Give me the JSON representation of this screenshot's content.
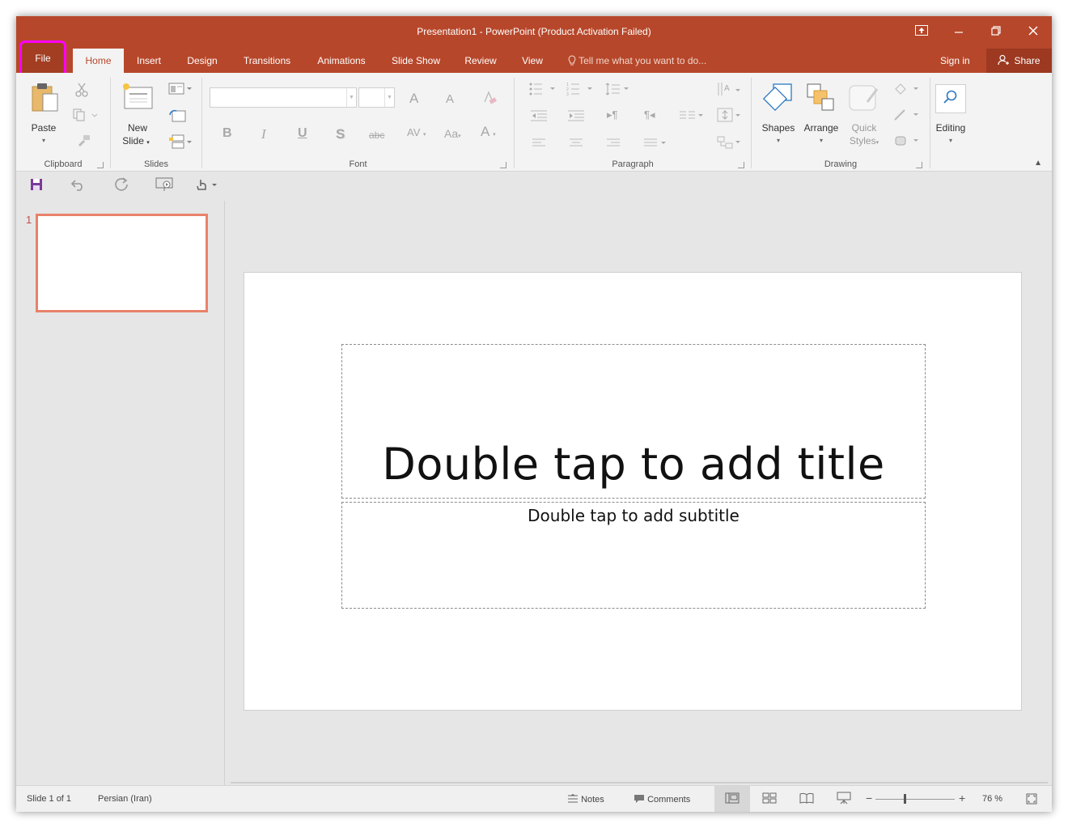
{
  "window": {
    "title": "Presentation1 - PowerPoint (Product Activation Failed)",
    "accent": "#b7472a"
  },
  "tabs": {
    "file": "File",
    "home": "Home",
    "insert": "Insert",
    "design": "Design",
    "transitions": "Transitions",
    "animations": "Animations",
    "slideshow": "Slide Show",
    "review": "Review",
    "view": "View",
    "tell_me": "Tell me what you want to do...",
    "sign_in": "Sign in",
    "share": "Share",
    "active": "Home"
  },
  "ribbon": {
    "clipboard": {
      "label": "Clipboard",
      "paste": "Paste"
    },
    "slides": {
      "label": "Slides",
      "new_slide_1": "New",
      "new_slide_2": "Slide"
    },
    "font": {
      "label": "Font",
      "bold": "B",
      "italic": "I",
      "underline": "U",
      "shadow": "S",
      "strike": "abc",
      "spacing": "AV",
      "case": "Aa",
      "color": "A",
      "grow": "A",
      "shrink": "A"
    },
    "paragraph": {
      "label": "Paragraph"
    },
    "drawing": {
      "label": "Drawing",
      "shapes": "Shapes",
      "arrange": "Arrange",
      "quick_styles_1": "Quick",
      "quick_styles_2": "Styles"
    },
    "editing": {
      "label": "Editing"
    }
  },
  "thumbnails": {
    "slide_number": "1"
  },
  "slide": {
    "title_placeholder": "Double tap to add title",
    "subtitle_placeholder": "Double tap to add subtitle"
  },
  "status": {
    "slide_info": "Slide 1 of 1",
    "language": "Persian (Iran)",
    "notes": "Notes",
    "comments": "Comments",
    "zoom": "76 %"
  },
  "icons": [
    "restore-ribbon-icon",
    "minimize-icon",
    "maximize-icon",
    "close-icon",
    "lightbulb-icon",
    "person-icon",
    "save-icon",
    "undo-icon",
    "redo-icon",
    "present-icon",
    "touch-mode-icon",
    "search-icon"
  ]
}
